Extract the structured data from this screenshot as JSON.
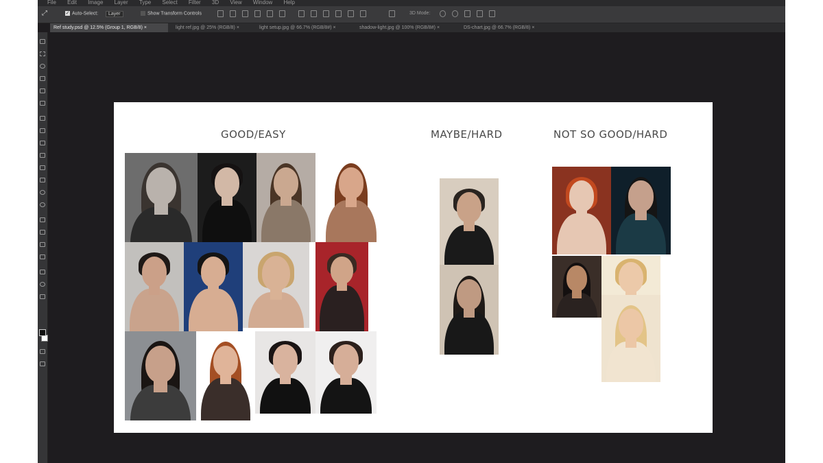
{
  "app": {
    "menu": [
      "File",
      "Edit",
      "Image",
      "Layer",
      "Type",
      "Select",
      "Filter",
      "3D",
      "View",
      "Window",
      "Help"
    ],
    "options": {
      "move_icon": "move-tool-icon",
      "auto_select_label": "Auto-Select:",
      "auto_select_value": "Layer",
      "transform_label": "Show Transform Controls",
      "mode_label": "3D Mode:"
    },
    "tabs": [
      {
        "label": "Ref study.psd @ 12.5% (Group 1, RGB/8)"
      },
      {
        "label": "light ref.jpg @ 25% (RGB/8)"
      },
      {
        "label": "light setup.jpg @ 66.7% (RGB/8#)"
      },
      {
        "label": "shadow-light.jpg @ 100% (RGB/8#)"
      },
      {
        "label": "DS-chart.jpg @ 66.7% (RGB/8)"
      }
    ],
    "close_glyph": "×"
  },
  "board": {
    "headings": {
      "good": "GOOD/EASY",
      "maybe": "MAYBE/HARD",
      "notgood": "NOT SO GOOD/HARD"
    }
  },
  "photos": [
    {
      "group": "good",
      "bg": "#6d6d6d",
      "skin": "#b9b2ac",
      "hair": "#3a3430",
      "cloth": "#2a2a2a",
      "hairshape": "long"
    },
    {
      "group": "good",
      "bg": "#1c1c1c",
      "skin": "#d2b8a6",
      "hair": "#151212",
      "cloth": "#0f0f0f",
      "hairshape": "back"
    },
    {
      "group": "good",
      "bg": "#b5aca5",
      "skin": "#caa890",
      "hair": "#4a3526",
      "cloth": "#8a7868",
      "hairshape": "long"
    },
    {
      "group": "good",
      "bg": "#ffffff",
      "skin": "#d8a68a",
      "hair": "#7a3d1f",
      "cloth": "#a8775c",
      "hairshape": "long"
    },
    {
      "group": "good",
      "bg": "#c2c0bd",
      "skin": "#cba088",
      "hair": "#1e1917",
      "cloth": "#c9a38c",
      "hairshape": "back"
    },
    {
      "group": "good",
      "bg": "#1f3f7a",
      "skin": "#d7ad92",
      "hair": "#141414",
      "cloth": "#d7ad92",
      "hairshape": "back"
    },
    {
      "group": "good",
      "bg": "#d9d6d4",
      "skin": "#d9b295",
      "hair": "#c9a56e",
      "cloth": "#d2ab92",
      "hairshape": "short"
    },
    {
      "group": "good",
      "bg": "#a8242a",
      "skin": "#d0a488",
      "hair": "#3a2a22",
      "cloth": "#2a2020",
      "hairshape": "back"
    },
    {
      "group": "good",
      "bg": "#8c8f93",
      "skin": "#c7a08a",
      "hair": "#1a1513",
      "cloth": "#3c3c3c",
      "hairshape": "long"
    },
    {
      "group": "good",
      "bg": "#ffffff",
      "skin": "#e0b499",
      "hair": "#a44f24",
      "cloth": "#3a2e2a",
      "hairshape": "long"
    },
    {
      "group": "good",
      "bg": "#e8e6e5",
      "skin": "#d9b39e",
      "hair": "#1a1414",
      "cloth": "#111111",
      "hairshape": "back"
    },
    {
      "group": "good",
      "bg": "#f0efef",
      "skin": "#d6ae98",
      "hair": "#2c201c",
      "cloth": "#141414",
      "hairshape": "back"
    },
    {
      "group": "maybe",
      "bg": "#d8cdbf",
      "skin": "#c9a288",
      "hair": "#2a2420",
      "cloth": "#1a1a1a",
      "hairshape": "back"
    },
    {
      "group": "maybe",
      "bg": "#cfc3b4",
      "skin": "#bf9a82",
      "hair": "#1f1a17",
      "cloth": "#181818",
      "hairshape": "long"
    },
    {
      "group": "notgood",
      "bg": "#8a3320",
      "skin": "#e6c7b3",
      "hair": "#c2491f",
      "cloth": "#e6c7b3",
      "hairshape": "short"
    },
    {
      "group": "notgood",
      "bg": "#0f1f2a",
      "skin": "#c5a08c",
      "hair": "#151515",
      "cloth": "#1b3a45",
      "hairshape": "long"
    },
    {
      "group": "notgood",
      "bg": "#3a2e28",
      "skin": "#b88866",
      "hair": "#141010",
      "cloth": "#2a2220",
      "hairshape": "long"
    },
    {
      "group": "notgood",
      "bg": "#f3ead6",
      "skin": "#ecc9a9",
      "hair": "#d9b36f",
      "cloth": "#efe1cc",
      "hairshape": "long"
    },
    {
      "group": "notgood",
      "bg": "#efe3cf",
      "skin": "#ecc7a6",
      "hair": "#e3c488",
      "cloth": "#f1e4d0",
      "hairshape": "long"
    }
  ]
}
